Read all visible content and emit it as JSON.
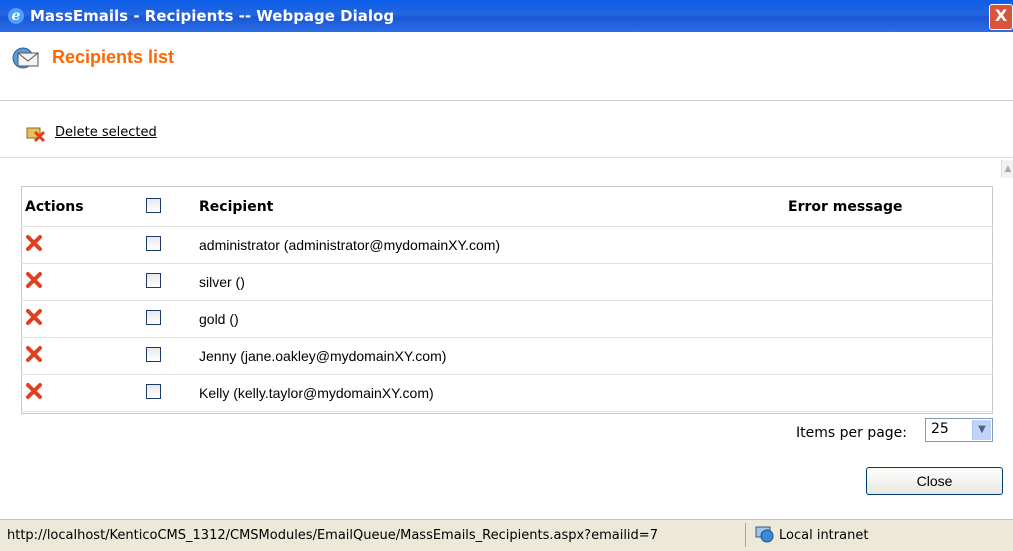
{
  "window": {
    "title": "MassEmails - Recipients -- Webpage Dialog",
    "close_glyph": "X"
  },
  "page": {
    "title": "Recipients list"
  },
  "toolbar": {
    "delete_label": "Delete selected"
  },
  "table": {
    "headers": {
      "actions": "Actions",
      "recipient": "Recipient",
      "error": "Error message"
    },
    "rows": [
      {
        "recipient": "administrator (administrator@mydomainXY.com)",
        "error": ""
      },
      {
        "recipient": "silver ()",
        "error": ""
      },
      {
        "recipient": "gold ()",
        "error": ""
      },
      {
        "recipient": "Jenny (jane.oakley@mydomainXY.com)",
        "error": ""
      },
      {
        "recipient": "Kelly (kelly.taylor@mydomainXY.com)",
        "error": ""
      }
    ]
  },
  "pager": {
    "label": "Items per page:",
    "value": "25"
  },
  "buttons": {
    "close": "Close"
  },
  "status": {
    "url": "http://localhost/KenticoCMS_1312/CMSModules/EmailQueue/MassEmails_Recipients.aspx?emailid=7",
    "zone": "Local intranet"
  },
  "colors": {
    "title_accent": "#ff6600",
    "titlebar": "#2466e0",
    "delete_icon": "#e04020"
  }
}
